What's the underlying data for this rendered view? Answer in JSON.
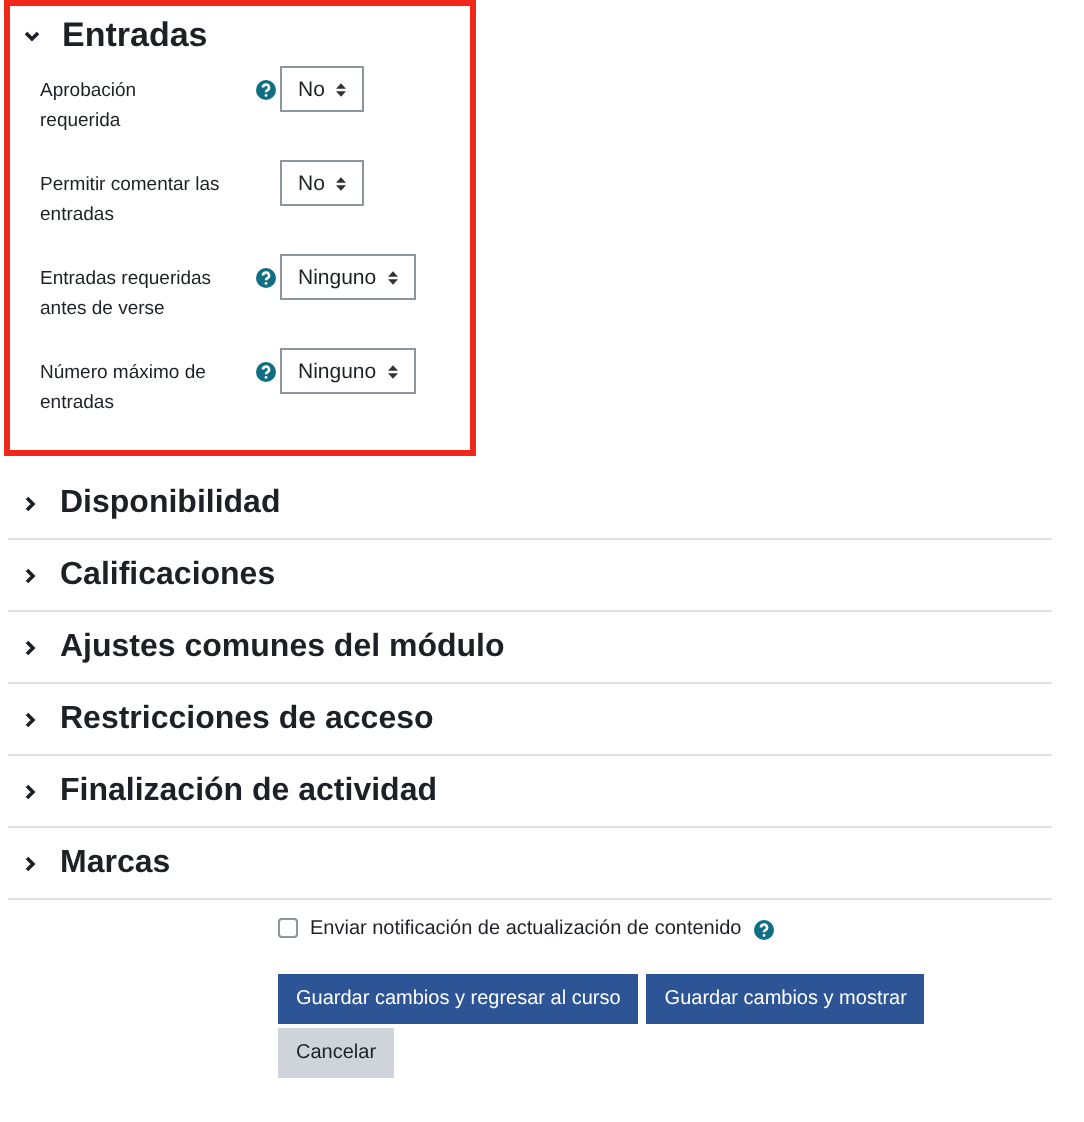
{
  "sections": [
    {
      "title": "Entradas",
      "expanded": true,
      "highlighted": true,
      "fields": [
        {
          "label": "Aprobación requerida",
          "help": true,
          "value": "No"
        },
        {
          "label": "Permitir comentar las entradas",
          "help": false,
          "value": "No"
        },
        {
          "label": "Entradas requeridas antes de verse",
          "help": true,
          "value": "Ninguno"
        },
        {
          "label": "Número máximo de entradas",
          "help": true,
          "value": "Ninguno"
        }
      ]
    },
    {
      "title": "Disponibilidad",
      "expanded": false,
      "highlighted": false
    },
    {
      "title": "Calificaciones",
      "expanded": false,
      "highlighted": false
    },
    {
      "title": "Ajustes comunes del módulo",
      "expanded": false,
      "highlighted": false
    },
    {
      "title": "Restricciones de acceso",
      "expanded": false,
      "highlighted": false
    },
    {
      "title": "Finalización de actividad",
      "expanded": false,
      "highlighted": false
    },
    {
      "title": "Marcas",
      "expanded": false,
      "highlighted": false
    }
  ],
  "notify": {
    "label": "Enviar notificación de actualización de contenido",
    "checked": false,
    "help": true
  },
  "buttons": [
    {
      "label": "Guardar cambios y regresar al curso",
      "kind": "primary"
    },
    {
      "label": "Guardar cambios y mostrar",
      "kind": "primary"
    },
    {
      "label": "Cancelar",
      "kind": "secondary"
    }
  ]
}
